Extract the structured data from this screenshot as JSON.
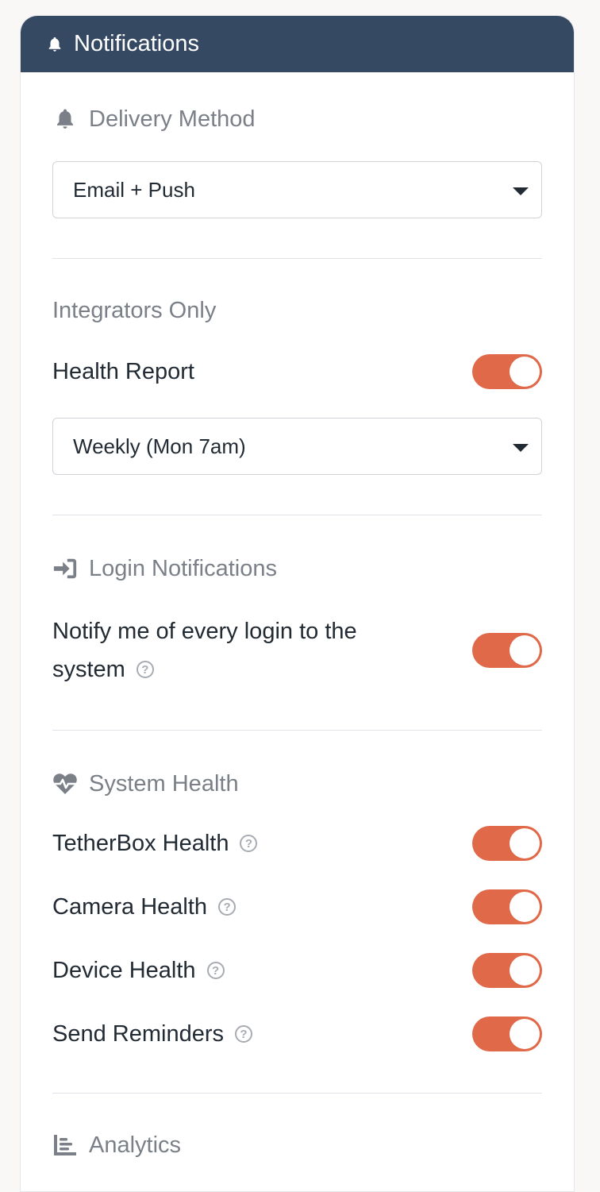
{
  "header": {
    "title": "Notifications",
    "icon": "bell-icon",
    "background_color": "#364962"
  },
  "delivery": {
    "title": "Delivery Method",
    "icon": "bell-icon",
    "selected": "Email + Push"
  },
  "integrators": {
    "title": "Integrators Only",
    "health_report_label": "Health Report",
    "health_report_enabled": true,
    "frequency_selected": "Weekly (Mon 7am)"
  },
  "login": {
    "title": "Login Notifications",
    "icon": "sign-in-icon",
    "notify_label_line1": "Notify me of every login to the",
    "notify_label_line2": "system",
    "notify_enabled": true
  },
  "system_health": {
    "title": "System Health",
    "icon": "heartbeat-icon",
    "items": [
      {
        "label": "TetherBox Health",
        "enabled": true
      },
      {
        "label": "Camera Health",
        "enabled": true
      },
      {
        "label": "Device Health",
        "enabled": true
      },
      {
        "label": "Send Reminders",
        "enabled": true
      }
    ]
  },
  "analytics": {
    "title": "Analytics",
    "icon": "chart-bars-icon"
  },
  "colors": {
    "toggle_on": "#e0694a",
    "section_title": "#7b8088",
    "text": "#222a33"
  }
}
